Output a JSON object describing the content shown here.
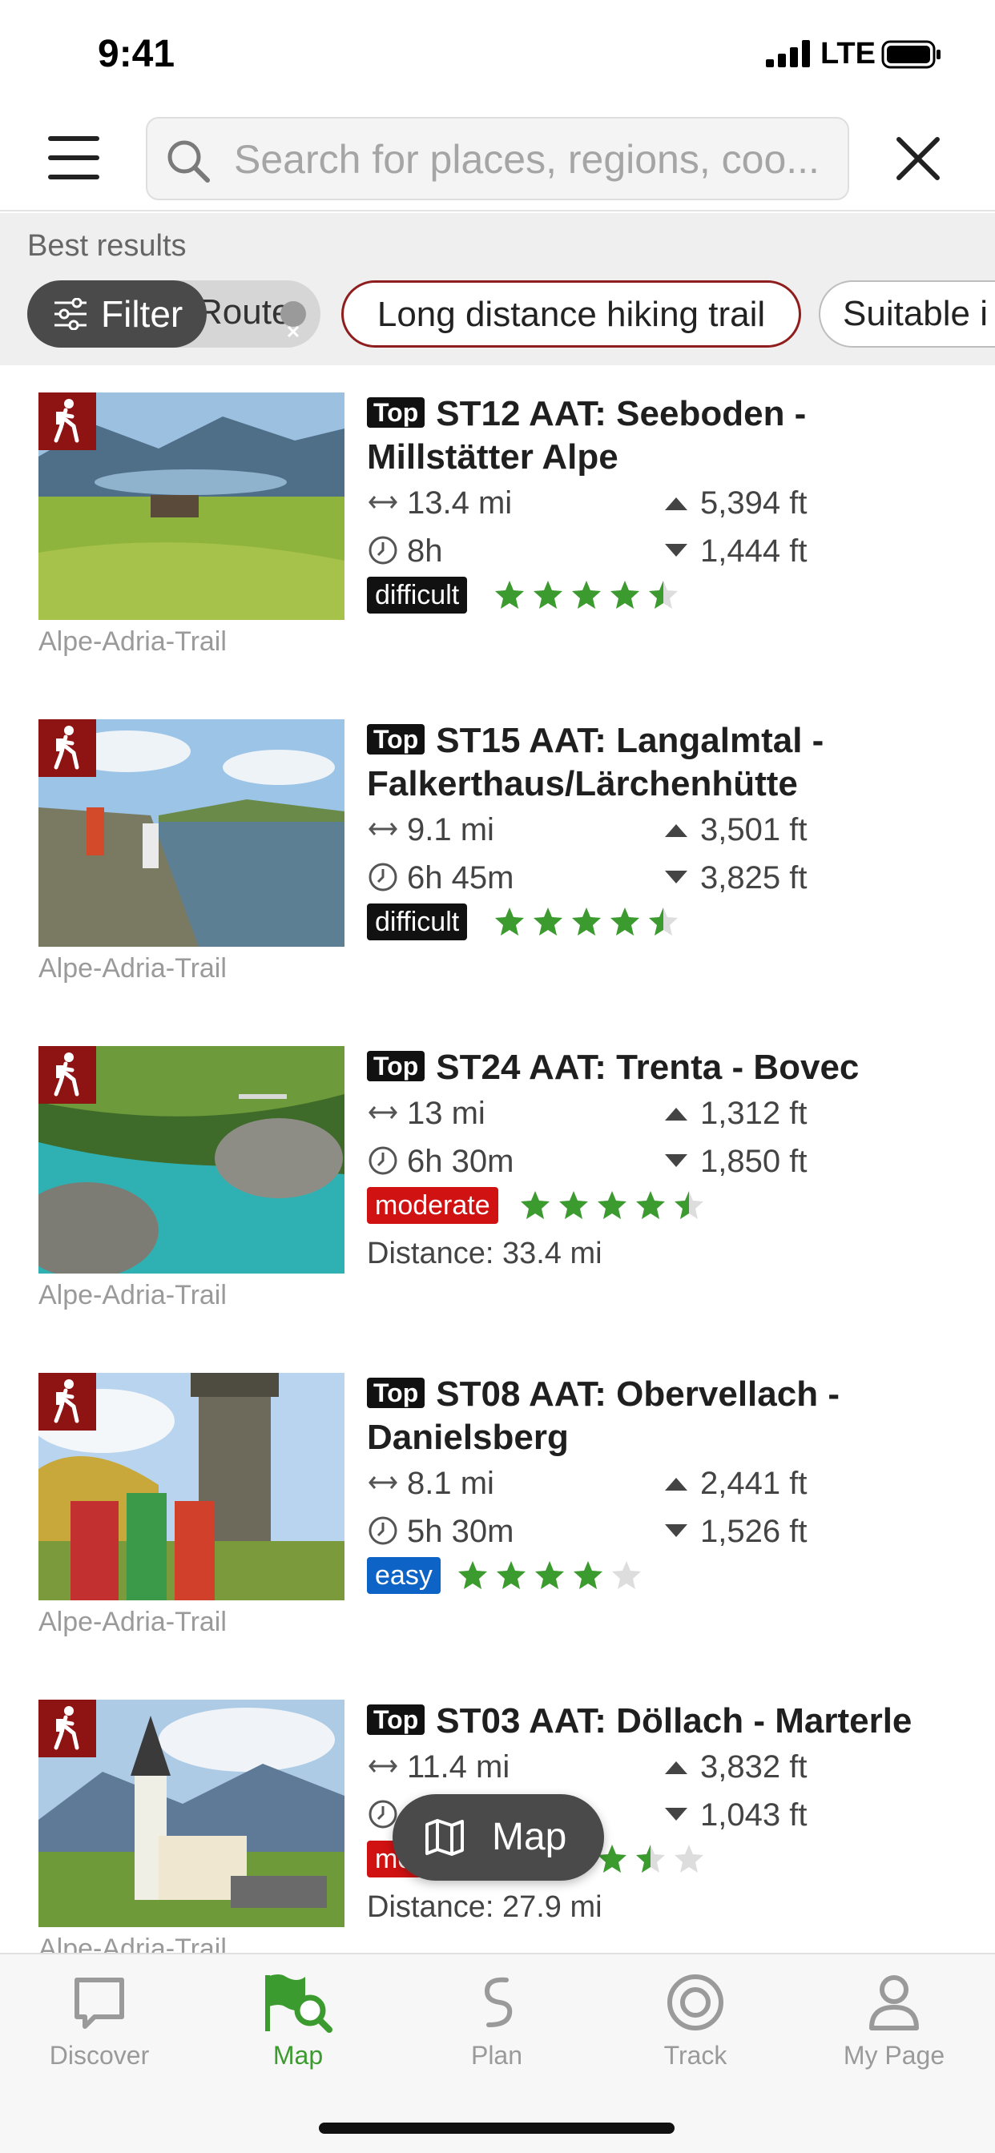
{
  "status_bar": {
    "time": "9:41",
    "network": "LTE"
  },
  "search": {
    "placeholder": "Search for places, regions, coo..."
  },
  "filters": {
    "section_label": "Best results",
    "filter_button": "Filter",
    "chips": [
      {
        "label": "Route"
      },
      {
        "label": "Long distance hiking trail"
      },
      {
        "label": "Suitable i"
      }
    ]
  },
  "results": [
    {
      "top_tag": "Top",
      "title": "ST12 AAT: Seeboden - Millstätter Alpe",
      "distance": "13.4 mi",
      "ascent": "5,394 ft",
      "duration": "8h",
      "descent": "1,444 ft",
      "difficulty": "difficult",
      "rating": 4.5,
      "extra": "",
      "region": "Alpe-Adria-Trail"
    },
    {
      "top_tag": "Top",
      "title": "ST15 AAT: Langalmtal - Falkerthaus/Lärchenhütte",
      "distance": "9.1 mi",
      "ascent": "3,501 ft",
      "duration": "6h 45m",
      "descent": "3,825 ft",
      "difficulty": "difficult",
      "rating": 4.5,
      "extra": "",
      "region": "Alpe-Adria-Trail"
    },
    {
      "top_tag": "Top",
      "title": "ST24 AAT: Trenta - Bovec",
      "distance": "13 mi",
      "ascent": "1,312 ft",
      "duration": "6h 30m",
      "descent": "1,850 ft",
      "difficulty": "moderate",
      "rating": 4.5,
      "extra": "Distance: 33.4 mi",
      "region": "Alpe-Adria-Trail"
    },
    {
      "top_tag": "Top",
      "title": "ST08 AAT: Obervellach - Danielsberg",
      "distance": "8.1 mi",
      "ascent": "2,441 ft",
      "duration": "5h 30m",
      "descent": "1,526 ft",
      "difficulty": "easy",
      "rating": 4,
      "extra": "",
      "region": "Alpe-Adria-Trail"
    },
    {
      "top_tag": "Top",
      "title": "ST03 AAT: Döllach - Marterle",
      "distance": "11.4 mi",
      "ascent": "3,832 ft",
      "duration": "",
      "descent": "1,043 ft",
      "difficulty": "moderate",
      "rating": 3.5,
      "extra": "Distance: 27.9 mi",
      "region": "Alpe-Adria-Trail"
    }
  ],
  "map_button": {
    "label": "Map"
  },
  "bottom_nav": {
    "items": [
      {
        "label": "Discover",
        "active": false
      },
      {
        "label": "Map",
        "active": true
      },
      {
        "label": "Plan",
        "active": false
      },
      {
        "label": "Track",
        "active": false
      },
      {
        "label": "My Page",
        "active": false
      }
    ]
  },
  "colors": {
    "accent_green": "#3c9b2e",
    "badge_red": "#8e1414",
    "chip_border": "#8f1d1d",
    "difficult": "#111111",
    "moderate": "#d11212",
    "easy": "#0e63c6"
  }
}
